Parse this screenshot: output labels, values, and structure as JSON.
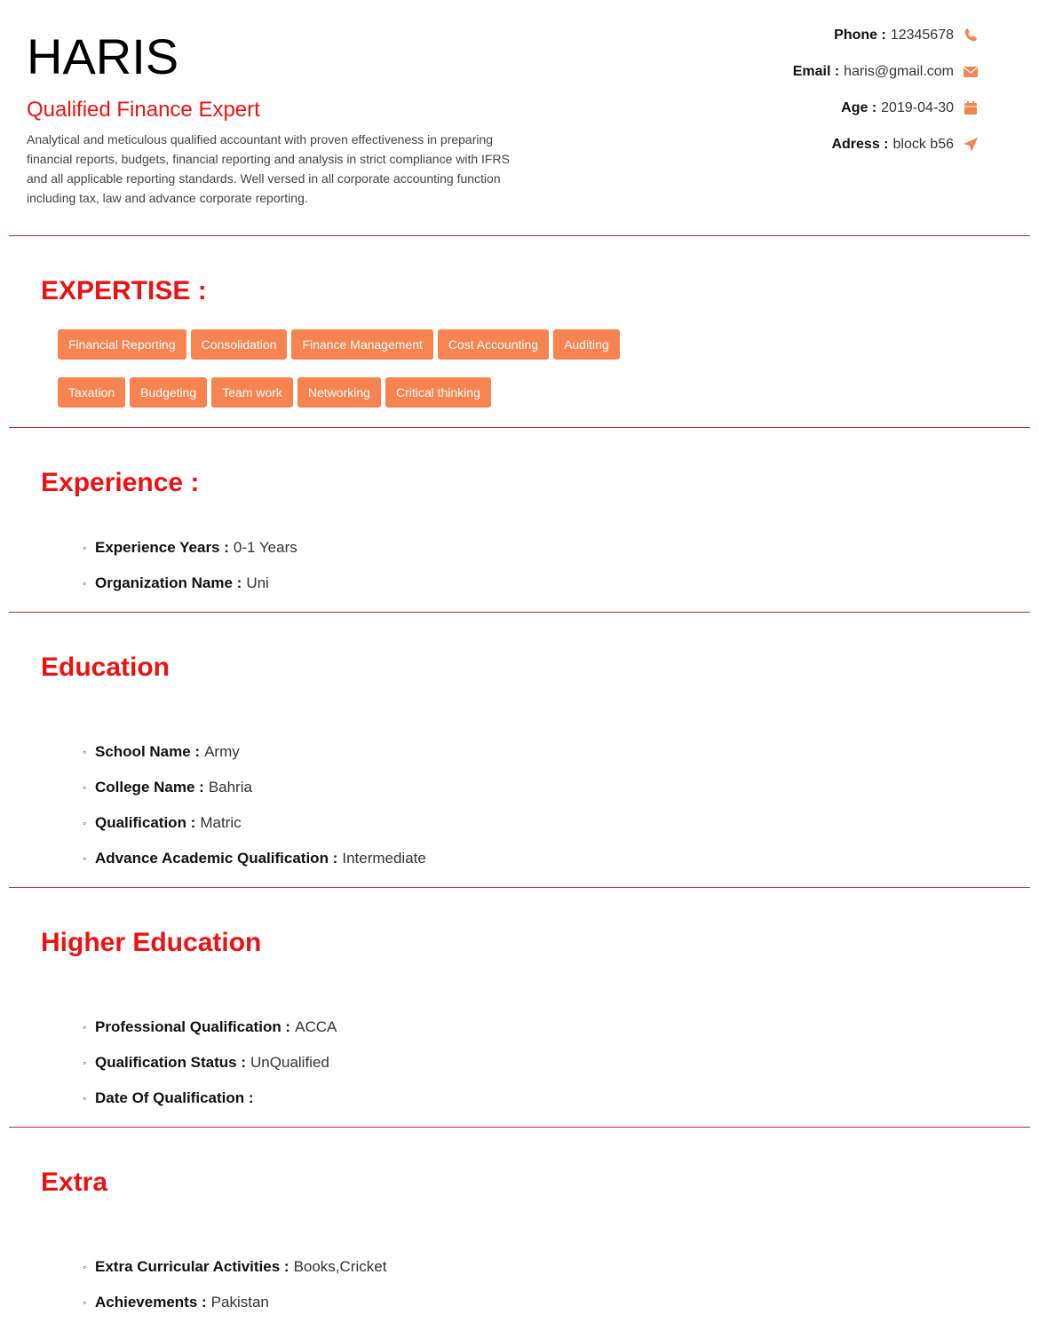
{
  "header": {
    "name": "HARIS",
    "title": "Qualified Finance Expert",
    "summary": "Analytical and meticulous qualified accountant with proven effectiveness in preparing financial reports, budgets, financial reporting and analysis in strict compliance with IFRS and all applicable reporting standards. Well versed in all corporate accounting function including tax, law and advance corporate reporting."
  },
  "contact": {
    "phone_label": "Phone :",
    "phone": "12345678",
    "phone_icon": "phone-icon",
    "email_label": "Email :",
    "email": "haris@gmail.com",
    "email_icon": "envelope-icon",
    "age_label": "Age :",
    "age": "2019-04-30",
    "age_icon": "calendar-icon",
    "address_label": "Adress :",
    "address": "block b56",
    "address_icon": "location-arrow-icon"
  },
  "colors": {
    "accent": "#ee1111",
    "tag": "#f68350",
    "icon": "#f68350",
    "divider": "#cc2222"
  },
  "expertise": {
    "title": "EXPERTISE :",
    "tags": [
      "Financial Reporting",
      "Consolidation",
      "Finance Management",
      "Cost Accounting",
      "Auditing",
      "Taxation",
      "Budgeting",
      "Team work",
      "Networking",
      "Critical thinking"
    ]
  },
  "experience": {
    "title": "Experience :",
    "items": [
      {
        "label": "Experience Years :",
        "value": "0-1 Years"
      },
      {
        "label": "Organization Name :",
        "value": "Uni"
      }
    ]
  },
  "education": {
    "title": "Education",
    "items": [
      {
        "label": "School Name :",
        "value": "Army"
      },
      {
        "label": "College Name :",
        "value": "Bahria"
      },
      {
        "label": "Qualification :",
        "value": "Matric"
      },
      {
        "label": "Advance Academic Qualification :",
        "value": "Intermediate"
      }
    ]
  },
  "higher_education": {
    "title": "Higher Education",
    "items": [
      {
        "label": "Professional Qualification :",
        "value": "ACCA"
      },
      {
        "label": "Qualification Status :",
        "value": "UnQualified"
      },
      {
        "label": "Date Of Qualification :",
        "value": ""
      }
    ]
  },
  "extra": {
    "title": "Extra",
    "items": [
      {
        "label": "Extra Curricular Activities :",
        "value": "Books,Cricket"
      },
      {
        "label": "Achievements :",
        "value": "Pakistan"
      }
    ]
  }
}
